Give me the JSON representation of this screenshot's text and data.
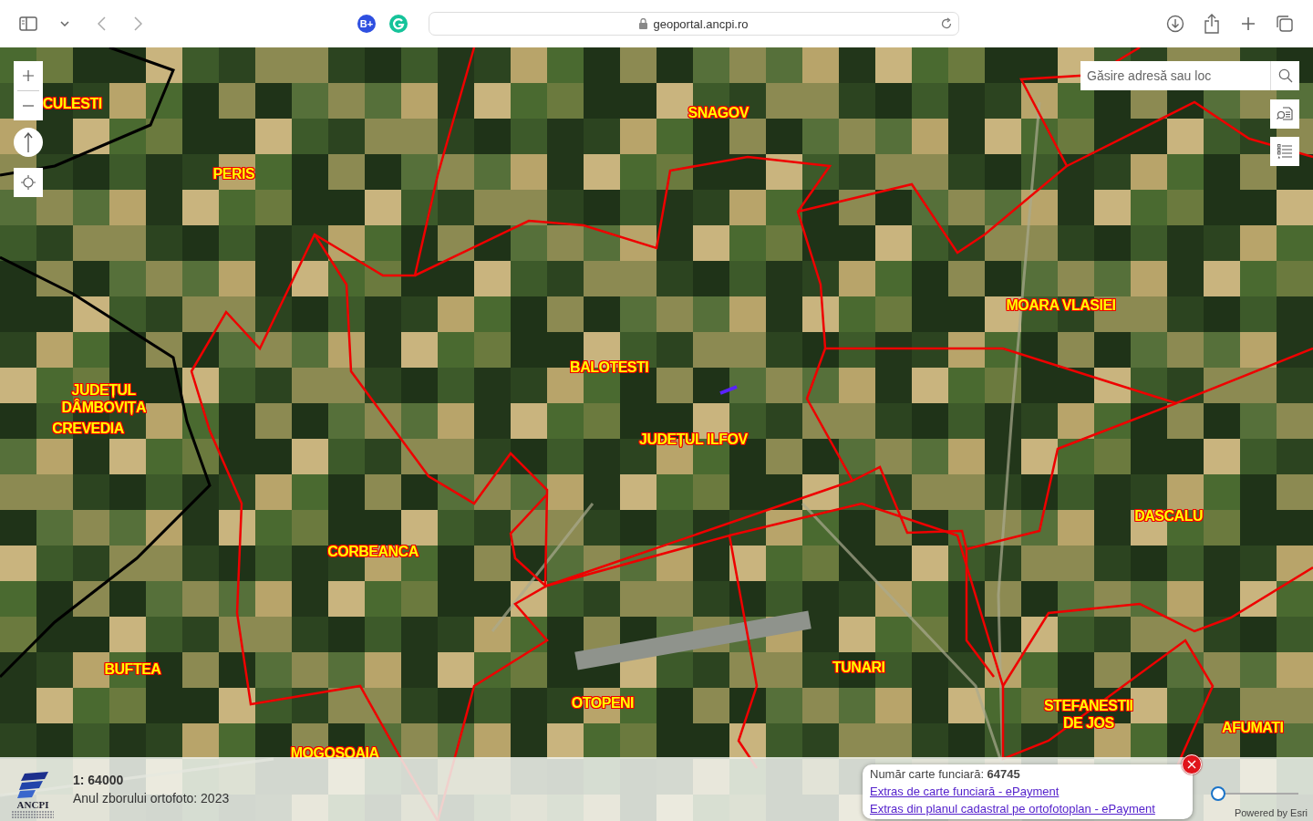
{
  "browser": {
    "url": "geoportal.ancpi.ro",
    "extension_badge": "B+"
  },
  "search": {
    "placeholder": "Găsire adresă sau loc"
  },
  "map_labels": [
    "CULESTI",
    "SNAGOV",
    "PERIS",
    "MOARA VLASIEI",
    "BALOTESTI",
    "JUDEȚUL\nDÂMBOVIȚA",
    "CREVEDIA",
    "JUDEȚUL ILFOV",
    "DASCALU",
    "CORBEANCA",
    "BUFTEA",
    "TUNARI",
    "OTOPENI",
    "STEFANESTII\nDE JOS",
    "AFUMATI",
    "MOGOSOAIA"
  ],
  "footer": {
    "scale": "1: 64000",
    "year": "Anul zborului ortofoto: 2023",
    "logo_text": "ANCPI",
    "powered_by": "Powered by Esri"
  },
  "popup": {
    "text": "Număr carte funciară: **64745**",
    "links": [
      "Extras de carte funciară - ePayment",
      "Extras din planul cadastral pe ortofotoplan - ePayment"
    ]
  },
  "opacity_slider": {
    "level": 0
  }
}
